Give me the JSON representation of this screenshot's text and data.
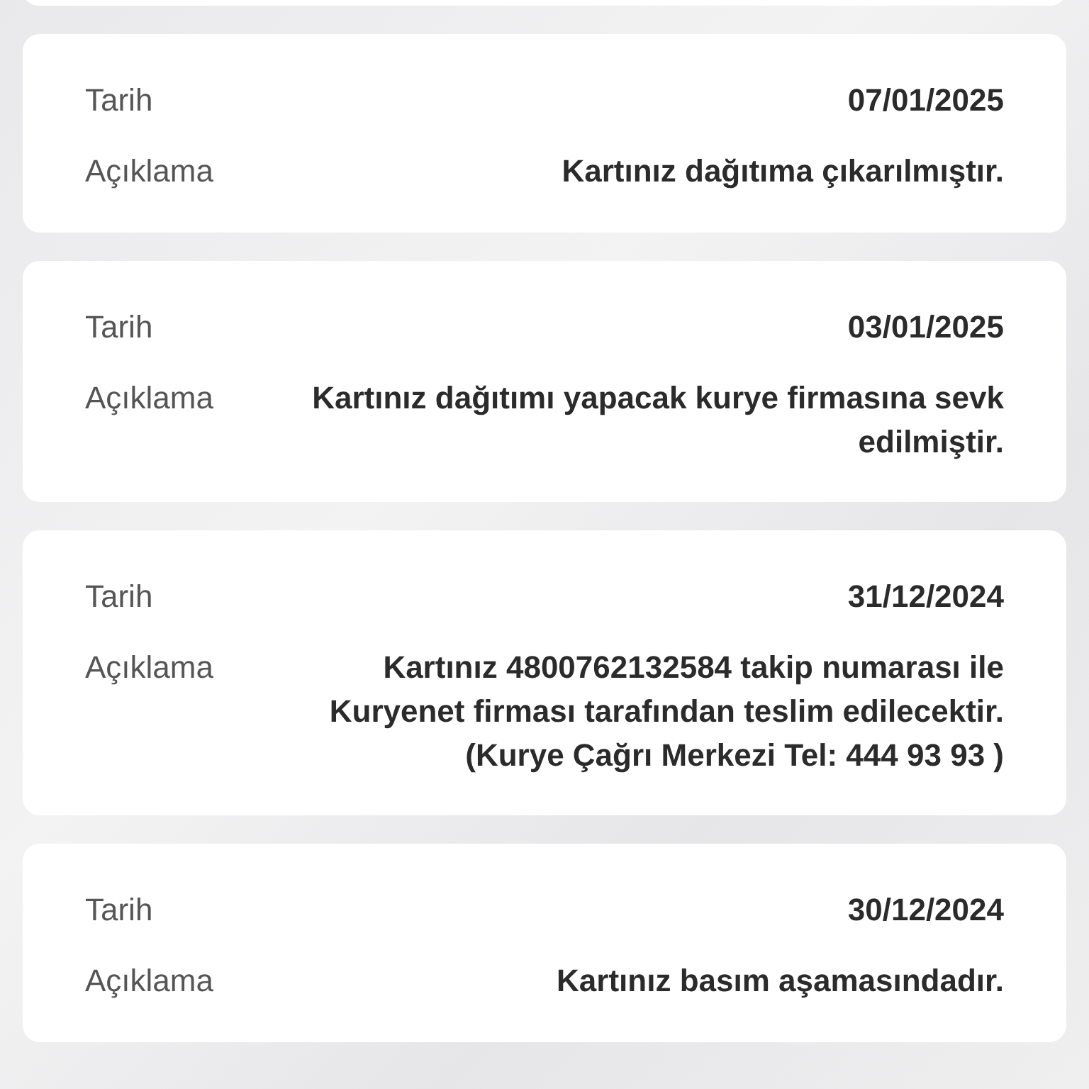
{
  "records": [
    {
      "fields": [
        {
          "label": "Tarih",
          "value": "07/01/2025"
        },
        {
          "label": "Açıklama",
          "value": "Kartınız dağıtıma çıkarılmıştır."
        }
      ]
    },
    {
      "fields": [
        {
          "label": "Tarih",
          "value": "03/01/2025"
        },
        {
          "label": "Açıklama",
          "value": "Kartınız dağıtımı yapacak kurye firmasına sevk edilmiştir."
        }
      ]
    },
    {
      "fields": [
        {
          "label": "Tarih",
          "value": "31/12/2024"
        },
        {
          "label": "Açıklama",
          "value": "Kartınız 4800762132584 takip numarası ile Kuryenet firması tarafından teslim edilecektir.(Kurye Çağrı Merkezi Tel: 444 93 93 )"
        }
      ]
    },
    {
      "fields": [
        {
          "label": "Tarih",
          "value": "30/12/2024"
        },
        {
          "label": "Açıklama",
          "value": "Kartınız basım aşamasındadır."
        }
      ]
    }
  ]
}
